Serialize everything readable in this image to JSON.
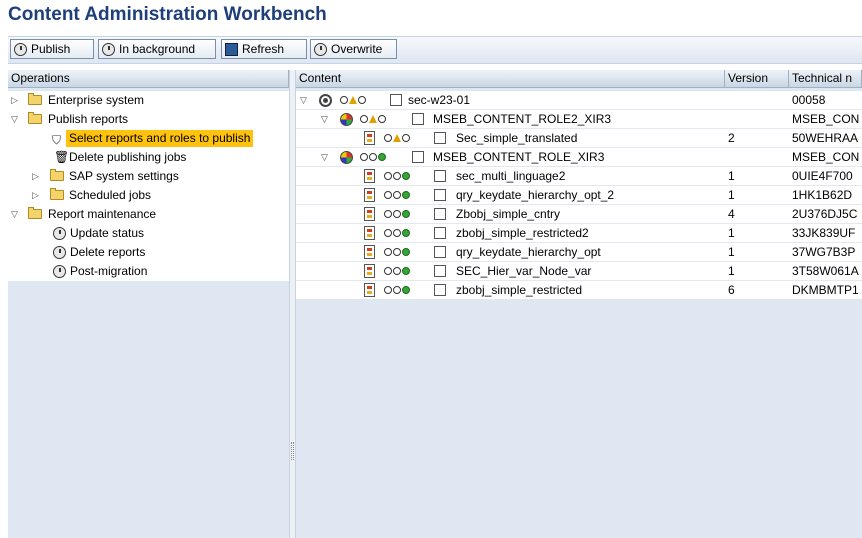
{
  "app": {
    "title": "Content Administration Workbench"
  },
  "toolbar": {
    "publish": "Publish",
    "in_background": "In background",
    "refresh": "Refresh",
    "overwrite": "Overwrite"
  },
  "operations": {
    "header": "Operations",
    "items": [
      {
        "label": "Enterprise system"
      },
      {
        "label": "Publish reports"
      },
      {
        "label": "Select reports and roles to publish"
      },
      {
        "label": "Delete publishing jobs"
      },
      {
        "label": "SAP system settings"
      },
      {
        "label": "Scheduled jobs"
      },
      {
        "label": "Report maintenance"
      },
      {
        "label": "Update status"
      },
      {
        "label": "Delete reports"
      },
      {
        "label": "Post-migration"
      }
    ]
  },
  "content": {
    "columns": {
      "content": "Content",
      "version": "Version",
      "technical": "Technical n"
    },
    "rows": [
      {
        "name": "sec-w23-01",
        "version": "",
        "technical": "00058"
      },
      {
        "name": "MSEB_CONTENT_ROLE2_XIR3",
        "version": "",
        "technical": "MSEB_CON"
      },
      {
        "name": "Sec_simple_translated",
        "version": "2",
        "technical": "50WEHRAA"
      },
      {
        "name": "MSEB_CONTENT_ROLE_XIR3",
        "version": "",
        "technical": "MSEB_CON"
      },
      {
        "name": "sec_multi_linguage2",
        "version": "1",
        "technical": "0UIE4F700"
      },
      {
        "name": "qry_keydate_hierarchy_opt_2",
        "version": "1",
        "technical": "1HK1B62D"
      },
      {
        "name": "Zbobj_simple_cntry",
        "version": "4",
        "technical": "2U376DJ5C"
      },
      {
        "name": "zbobj_simple_restricted2",
        "version": "1",
        "technical": "33JK839UF"
      },
      {
        "name": "qry_keydate_hierarchy_opt",
        "version": "1",
        "technical": "37WG7B3P"
      },
      {
        "name": "SEC_Hier_var_Node_var",
        "version": "1",
        "technical": "3T58W061A"
      },
      {
        "name": "zbobj_simple_restricted",
        "version": "6",
        "technical": "DKMBMTP1"
      }
    ]
  }
}
